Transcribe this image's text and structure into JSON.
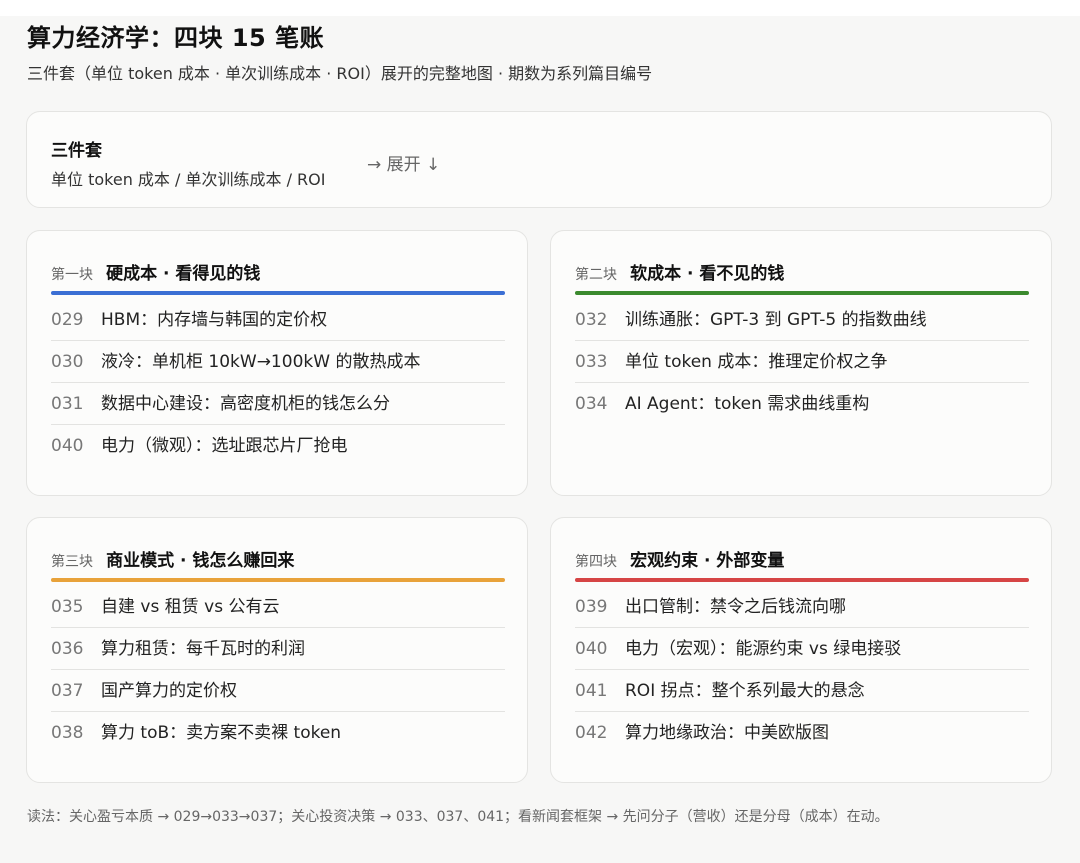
{
  "header": {
    "title": "算力经济学：四块 15 笔账",
    "subtitle": "三件套（单位 token 成本 · 单次训练成本 · ROI）展开的完整地图 · 期数为系列篇目编号"
  },
  "summary": {
    "title": "三件套",
    "subtitle": "单位 token 成本 / 单次训练成本 / ROI",
    "expand_label": "→ 展开 ↓"
  },
  "blocks": [
    {
      "index_label": "第一块",
      "title": "硬成本 · 看得见的钱",
      "color": "#3b6fd4",
      "items": [
        {
          "num": "029",
          "text": "HBM：内存墙与韩国的定价权"
        },
        {
          "num": "030",
          "text": "液冷：单机柜 10kW→100kW 的散热成本"
        },
        {
          "num": "031",
          "text": "数据中心建设：高密度机柜的钱怎么分"
        },
        {
          "num": "040",
          "text": "电力（微观）：选址跟芯片厂抢电"
        }
      ]
    },
    {
      "index_label": "第二块",
      "title": "软成本 · 看不见的钱",
      "color": "#3b8a2e",
      "items": [
        {
          "num": "032",
          "text": "训练通胀：GPT-3 到 GPT-5 的指数曲线"
        },
        {
          "num": "033",
          "text": "单位 token 成本：推理定价权之争"
        },
        {
          "num": "034",
          "text": "AI Agent：token 需求曲线重构"
        }
      ]
    },
    {
      "index_label": "第三块",
      "title": "商业模式 · 钱怎么赚回来",
      "color": "#e8a23a",
      "items": [
        {
          "num": "035",
          "text": "自建 vs 租赁 vs 公有云"
        },
        {
          "num": "036",
          "text": "算力租赁：每千瓦时的利润"
        },
        {
          "num": "037",
          "text": "国产算力的定价权"
        },
        {
          "num": "038",
          "text": "算力 toB：卖方案不卖裸 token"
        }
      ]
    },
    {
      "index_label": "第四块",
      "title": "宏观约束 · 外部变量",
      "color": "#d64545",
      "items": [
        {
          "num": "039",
          "text": "出口管制：禁令之后钱流向哪"
        },
        {
          "num": "040",
          "text": "电力（宏观）：能源约束 vs 绿电接驳"
        },
        {
          "num": "041",
          "text": "ROI 拐点：整个系列最大的悬念"
        },
        {
          "num": "042",
          "text": "算力地缘政治：中美欧版图"
        }
      ]
    }
  ],
  "footnote": "读法：关心盈亏本质 → 029→033→037；关心投资决策 → 033、037、041；看新闻套框架 → 先问分子（营收）还是分母（成本）在动。"
}
